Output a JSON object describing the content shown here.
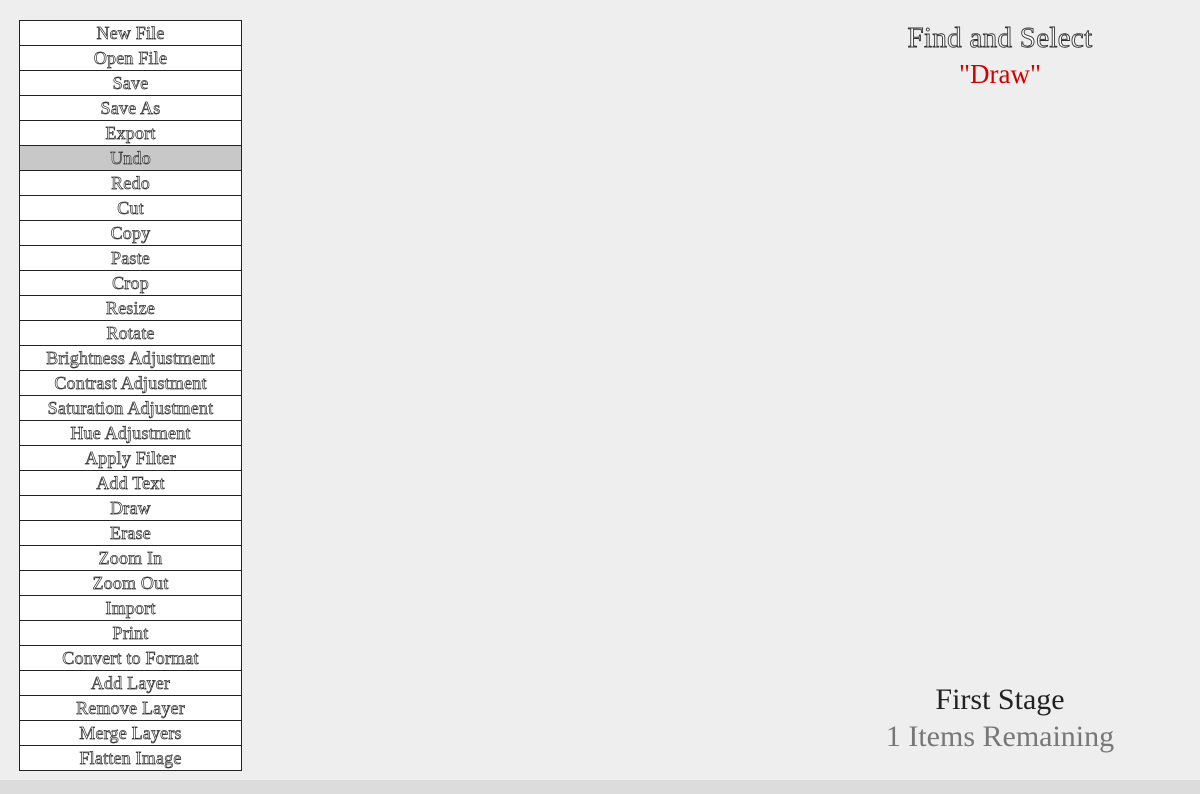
{
  "menu": {
    "items": [
      "New File",
      "Open File",
      "Save",
      "Save As",
      "Export",
      "Undo",
      "Redo",
      "Cut",
      "Copy",
      "Paste",
      "Crop",
      "Resize",
      "Rotate",
      "Brightness Adjustment",
      "Contrast Adjustment",
      "Saturation Adjustment",
      "Hue Adjustment",
      "Apply Filter",
      "Add Text",
      "Draw",
      "Erase",
      "Zoom In",
      "Zoom Out",
      "Import",
      "Print",
      "Convert to Format",
      "Add Layer",
      "Remove Layer",
      "Merge Layers",
      "Flatten Image"
    ],
    "highlighted_item": "Undo",
    "highlight_color": "#c8c8c8"
  },
  "instruction": {
    "title": "Find and Select",
    "target": "\"Draw\"",
    "target_color": "#d40000"
  },
  "status": {
    "stage": "First Stage",
    "remaining": "1 Items Remaining"
  }
}
